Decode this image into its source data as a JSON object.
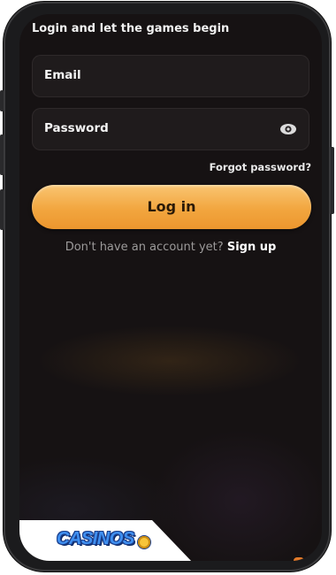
{
  "login": {
    "headline": "Login and let the games begin",
    "email_label": "Email",
    "password_label": "Password",
    "forgot_label": "Forgot password?",
    "login_button": "Log in",
    "signup_prompt": "Don't have an account yet?",
    "signup_link": "Sign up"
  },
  "brand": {
    "logo_text": "CASINOS"
  },
  "icons": {
    "password_toggle": "eye-icon"
  },
  "colors": {
    "accent": "#f2a63f",
    "background": "#161213",
    "field_background": "#1f1b1c"
  }
}
